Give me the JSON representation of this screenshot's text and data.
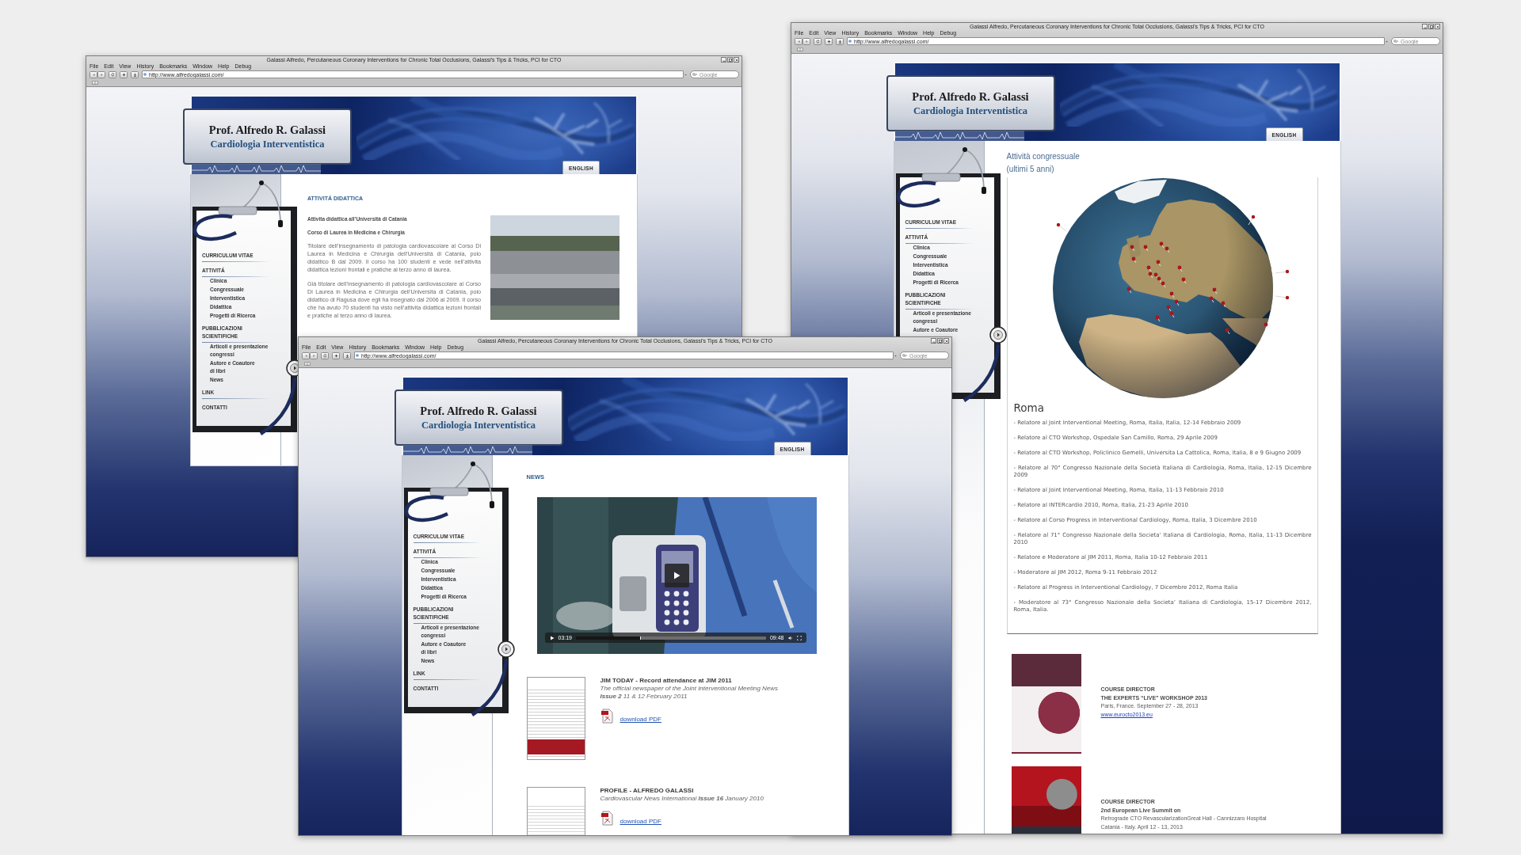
{
  "windows": [
    {
      "kind": "teaching",
      "title": "Galassi Alfredo, Percutaneous Coronary Interventions for Chronic Total Occlusions, Galassi's Tips & Tricks, PCI for CTO",
      "menu": [
        "File",
        "Edit",
        "View",
        "History",
        "Bookmarks",
        "Window",
        "Help",
        "Debug"
      ],
      "url": "http://www.alfredogalassi.com/",
      "search": {
        "placeholder": "Google"
      },
      "site": {
        "name": "Prof. Alfredo R. Galassi",
        "subtitle": "Cardiologia Interventistica",
        "language_tab": "ENGLISH",
        "nav": [
          {
            "lines": [
              "CURRICULUM VITAE"
            ]
          },
          {
            "lines": [
              "ATTIVITÁ"
            ],
            "children": [
              {
                "lines": [
                  "Clinica"
                ]
              },
              {
                "lines": [
                  "Congressuale"
                ]
              },
              {
                "lines": [
                  "Interventistica"
                ]
              },
              {
                "lines": [
                  "Didattica"
                ]
              },
              {
                "lines": [
                  "Progetti di Ricerca"
                ]
              }
            ]
          },
          {
            "lines": [
              "PUBBLICAZIONI",
              "SCIENTIFICHE"
            ],
            "children": [
              {
                "lines": [
                  "Articoli e presentazione",
                  "congressi"
                ]
              },
              {
                "lines": [
                  "Autore e Coautore",
                  "di libri"
                ]
              },
              {
                "lines": [
                  "News"
                ]
              }
            ]
          },
          {
            "lines": [
              "LINK"
            ]
          },
          {
            "lines": [
              "CONTATTI"
            ]
          }
        ]
      },
      "content": {
        "heading": "ATTIVITÁ DIDATTICA",
        "blocks": [
          {
            "kind": "subheading",
            "text": "Attivita didattica all’Università di Catania"
          },
          {
            "kind": "subheading",
            "text": "Corso di Laurea in Medicina e Chirurgia"
          },
          {
            "kind": "paragraph",
            "text": "Titolare dell’insegnamento di patologia cardiovascolare al Corso Di Laurea in Medicina e Chirurgia dell’Università di Catania, polo didattico B dal 2009. Il corso ha 100 studenti e vede nell’attivita didattica lezioni frontali e pratiche al terzo anno di laurea."
          },
          {
            "kind": "paragraph",
            "text": "Già titolare dell’insegnamento di patologia cardiovascolare al Corso Di Laurea in Medicina e Chirurgia dell’Universita di Catania, polo didattico di Ragusa dove egli ha insegnato dal 2006 al 2009. Il corso che ha avuto 70 studenti ha visto nell’attivita didattica lezioni frontali e pratiche al terzo anno di laurea."
          }
        ]
      }
    },
    {
      "kind": "congress",
      "title": "Galassi Alfredo, Percutaneous Coronary Interventions for Chronic Total Occlusions, Galassi's Tips & Tricks, PCI for CTO",
      "menu": [
        "File",
        "Edit",
        "View",
        "History",
        "Bookmarks",
        "Window",
        "Help",
        "Debug"
      ],
      "url": "http://www.alfredogalassi.com/",
      "search": {
        "placeholder": "Google"
      },
      "site": {
        "name": "Prof. Alfredo R. Galassi",
        "subtitle": "Cardiologia Interventistica",
        "language_tab": "ENGLISH",
        "nav": [
          {
            "lines": [
              "CURRICULUM VITAE"
            ]
          },
          {
            "lines": [
              "ATTIVITÁ"
            ],
            "children": [
              {
                "lines": [
                  "Clinica"
                ]
              },
              {
                "lines": [
                  "Congressuale"
                ]
              },
              {
                "lines": [
                  "Interventistica"
                ]
              },
              {
                "lines": [
                  "Didattica"
                ]
              },
              {
                "lines": [
                  "Progetti di Ricerca"
                ]
              }
            ]
          },
          {
            "lines": [
              "PUBBLICAZIONI",
              "SCIENTIFICHE"
            ],
            "children": [
              {
                "lines": [
                  "Articoli e presentazione",
                  "congressi"
                ]
              },
              {
                "lines": [
                  "Autore e Coautore"
                ]
              }
            ]
          }
        ]
      },
      "content": {
        "title": "Attività congressuale (ultimi 5 anni)",
        "city": "Roma",
        "events": [
          "- Relatore al Joint Interventional Meeting, Roma, Italia, Italia, 12-14 Febbraio 2009",
          "- Relatore al CTO Workshop, Ospedale San Camillo, Roma, 29 Aprile 2009",
          "- Relatore al CTO Workshop, Policlinico Gemelli, Universita La Cattolica, Roma, Italia, 8 e 9 Giugno 2009",
          "- Relatore al 70° Congresso Nazionale della Società Italiana di Cardiologia, Roma, Italia, 12-15 Dicembre 2009",
          "- Relatore al Joint Interventional Meeting, Roma, Italia, 11-13 Febbraio 2010",
          "- Relatore al INTERcardio 2010, Roma, Italia, 21-23 Aprile 2010",
          "- Relatore al Corso Progress in Interventional Cardiology, Roma, Italia, 3 Dicembre 2010",
          "- Relatore al 71° Congresso Nazionale della Societa’ Italiana di Cardiologia, Roma, Italia, 11-13 Dicembre 2010",
          "- Relatore e Moderatore al JIM 2011, Roma, Italia 10-12 Febbraio 2011",
          "- Moderatore al JIM 2012, Roma 9-11 Febbraio 2012",
          "- Relatore al Progress in Interventional Cardiology, 7 Dicembre 2012, Roma Italia",
          "- Moderatore al 73° Congresso Nazionale della Societa’ Italiana di Cardiologia, 15-17 Dicembre 2012, Roma, Italia."
        ],
        "courses": [
          {
            "role": "COURSE DIRECTOR",
            "title": "THE EXPERTS “LIVE” WORKSHOP 2013",
            "details": [
              "Paris, France. September 27 - 28, 2013"
            ],
            "link": "www.eurocto2013.eu"
          },
          {
            "role": "COURSE DIRECTOR",
            "title": "2nd European Live Summit on",
            "details": [
              "Retrograde CTO RevascularizationGreat Hall - Cannizzaro Hospital",
              "Catania - Italy. April 12 - 13, 2013"
            ]
          }
        ]
      }
    },
    {
      "kind": "news",
      "title": "Galassi Alfredo, Percutaneous Coronary Interventions for Chronic Total Occlusions, Galassi's Tips & Tricks, PCI for CTO",
      "menu": [
        "File",
        "Edit",
        "View",
        "History",
        "Bookmarks",
        "Window",
        "Help",
        "Debug"
      ],
      "url": "http://www.alfredogalassi.com/",
      "search": {
        "placeholder": "Google"
      },
      "site": {
        "name": "Prof. Alfredo R. Galassi",
        "subtitle": "Cardiologia Interventistica",
        "language_tab": "ENGLISH",
        "nav": [
          {
            "lines": [
              "CURRICULUM VITAE"
            ]
          },
          {
            "lines": [
              "ATTIVITÁ"
            ],
            "children": [
              {
                "lines": [
                  "Clinica"
                ]
              },
              {
                "lines": [
                  "Congressuale"
                ]
              },
              {
                "lines": [
                  "Interventistica"
                ]
              },
              {
                "lines": [
                  "Didattica"
                ]
              },
              {
                "lines": [
                  "Progetti di Ricerca"
                ]
              }
            ]
          },
          {
            "lines": [
              "PUBBLICAZIONI",
              "SCIENTIFICHE"
            ],
            "children": [
              {
                "lines": [
                  "Articoli e presentazione",
                  "congressi"
                ]
              },
              {
                "lines": [
                  "Autore e Coautore",
                  "di libri"
                ]
              },
              {
                "lines": [
                  "News"
                ]
              }
            ]
          },
          {
            "lines": [
              "LINK"
            ]
          },
          {
            "lines": [
              "CONTATTI"
            ]
          }
        ]
      },
      "content": {
        "heading": "NEWS",
        "video": {
          "elapsed": "03:19",
          "duration": "09:48",
          "level": 0.34
        },
        "items": [
          {
            "title": "JIM TODAY - Record attendance at JIM 2011",
            "description_lines": [
              "The official newspaper of the Joint Interventional Meeting News",
              "**Issue 2** 11 & 12 February 2011"
            ],
            "link": "download PDF"
          },
          {
            "title": "PROFILE - ALFREDO GALASSI",
            "description_lines": [
              "Cardiovascular News International **Issue 16** January 2010"
            ],
            "link": "download PDF"
          }
        ]
      }
    }
  ]
}
